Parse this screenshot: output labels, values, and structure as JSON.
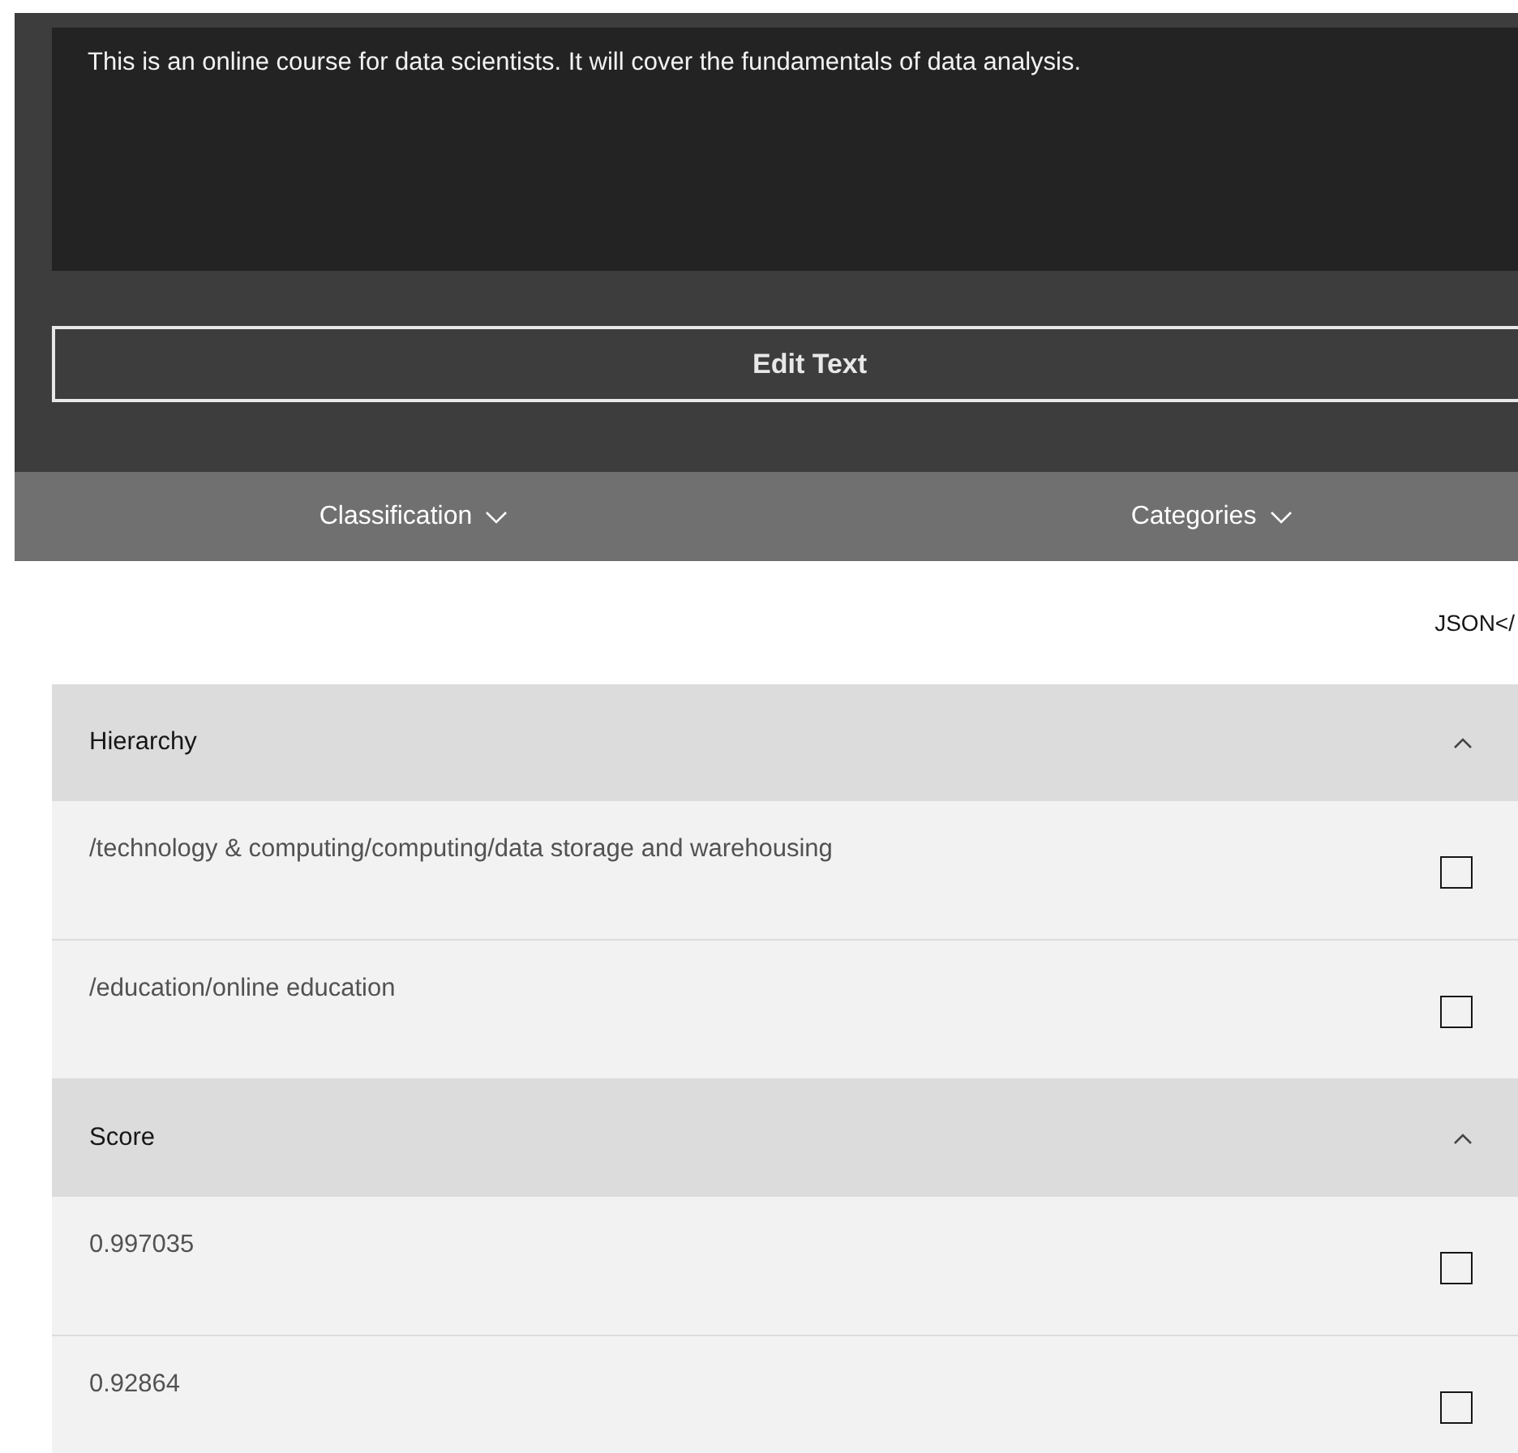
{
  "description": {
    "value": "This is an online course for data scientists. It will cover the fundamentals of data analysis."
  },
  "edit_button": "Edit Text",
  "tabs": [
    {
      "label": "Classification"
    },
    {
      "label": "Categories"
    }
  ],
  "json_link": "JSON</",
  "sections": [
    {
      "title": "Hierarchy",
      "expanded": true,
      "rows": [
        {
          "text": "/technology & computing/computing/data storage and warehousing",
          "checked": false
        },
        {
          "text": "/education/online education",
          "checked": false
        }
      ]
    },
    {
      "title": "Score",
      "expanded": true,
      "rows": [
        {
          "text": "0.997035",
          "checked": false
        },
        {
          "text": "0.92864",
          "checked": false
        }
      ]
    }
  ]
}
